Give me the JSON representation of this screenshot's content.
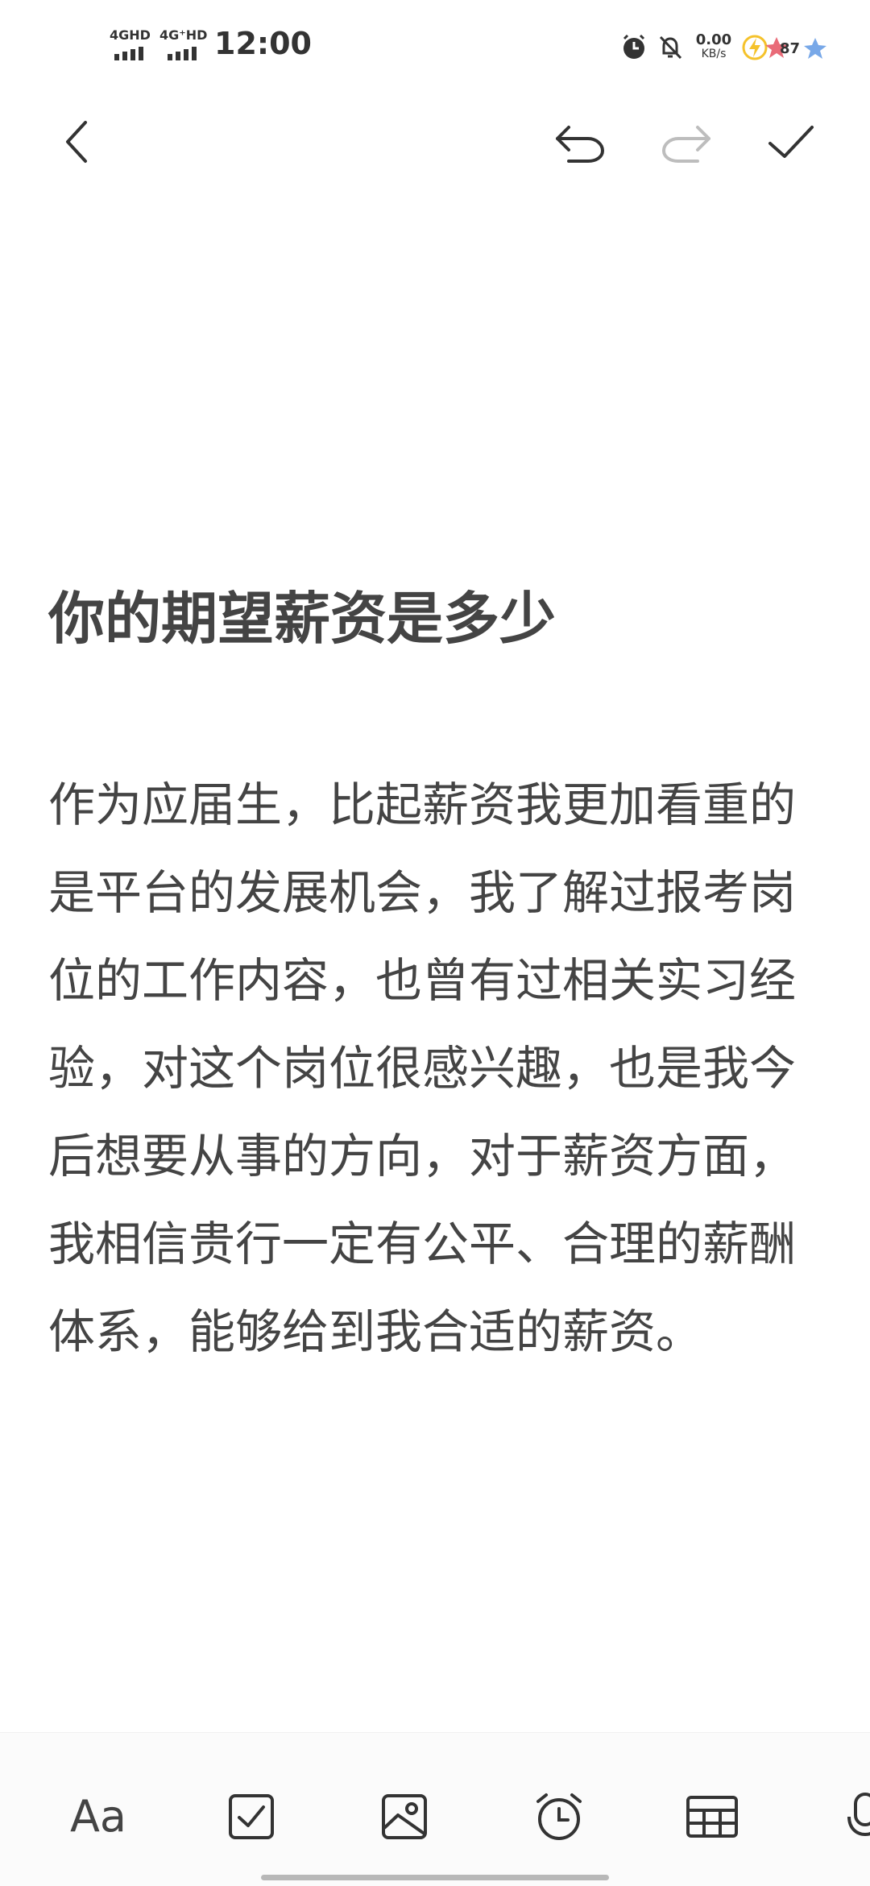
{
  "status_bar": {
    "network_1": "4GHD",
    "network_2": "4G⁺HD",
    "time": "12:00",
    "net_speed": "0.00",
    "net_speed_unit": "KB/s",
    "battery": "87"
  },
  "editor": {
    "title": "你的期望薪资是多少",
    "body": "作为应届生，比起薪资我更加看重的是平台的发展机会，我了解过报考岗位的工作内容，也曾有过相关实习经验，对这个岗位很感兴趣，也是我今后想要从事的方向，对于薪资方面，我相信贵行一定有公平、合理的薪酬体系，能够给到我合适的薪资。"
  },
  "toolbar": {
    "text_style_label": "Aa"
  },
  "icons": {
    "back": "back-arrow-icon",
    "undo": "undo-icon",
    "redo": "redo-icon",
    "done": "check-icon",
    "checklist": "checkbox-icon",
    "image": "image-icon",
    "reminder": "alarm-clock-icon",
    "table": "table-icon",
    "voice": "microphone-icon"
  },
  "colors": {
    "text": "#444444",
    "disabled_icon": "#bdbdbd",
    "battery_accent": "#f5c22b"
  }
}
